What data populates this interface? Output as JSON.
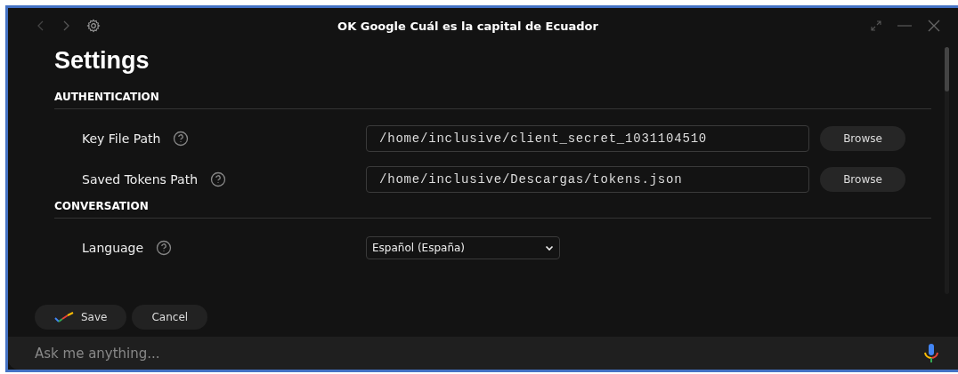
{
  "window": {
    "title": "OK Google Cuál es la capital de Ecuador"
  },
  "page_title": "Settings",
  "sections": [
    {
      "heading": "AUTHENTICATION",
      "rows": [
        {
          "kind": "file",
          "label": "Key File Path",
          "value": "/home/inclusive/client_secret_1031104510",
          "button": "Browse"
        },
        {
          "kind": "file",
          "label": "Saved Tokens Path",
          "value": "/home/inclusive/Descargas/tokens.json",
          "button": "Browse"
        }
      ]
    },
    {
      "heading": "CONVERSATION",
      "rows": [
        {
          "kind": "select",
          "label": "Language",
          "value": "Español (España)"
        }
      ]
    }
  ],
  "buttons": [
    "Save",
    "Cancel"
  ],
  "input": {
    "placeholder": "Ask me anything..."
  }
}
